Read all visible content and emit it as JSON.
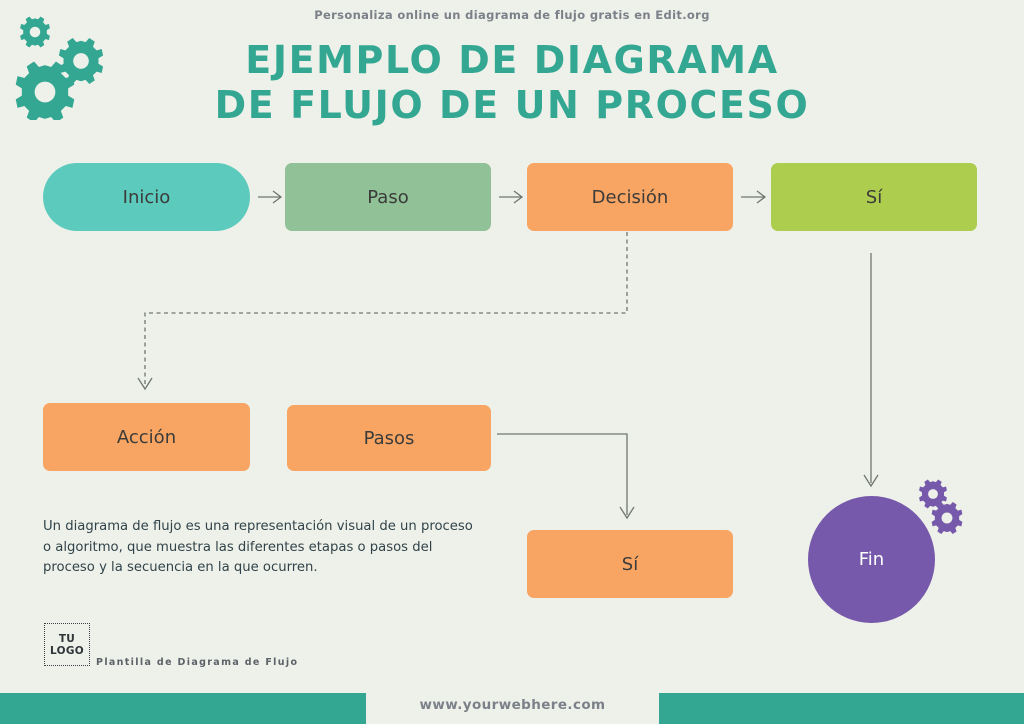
{
  "header": {
    "tagline": "Personaliza online un diagrama de flujo gratis en Edit.org",
    "title_line1": "EJEMPLO DE DIAGRAMA",
    "title_line2": "DE FLUJO DE UN PROCESO"
  },
  "colors": {
    "background": "#eef1e9",
    "teal": "#34a793",
    "start_node": "#5ccbbd",
    "step_node": "#90c197",
    "orange_node": "#f8a564",
    "lime_node": "#accd4d",
    "end_node": "#7759ab",
    "connector": "#6f7672",
    "text_dark": "#3b3b39",
    "text_muted": "#7c8189"
  },
  "nodes": [
    {
      "id": "inicio",
      "label": "Inicio"
    },
    {
      "id": "paso",
      "label": "Paso"
    },
    {
      "id": "decision",
      "label": "Decisión"
    },
    {
      "id": "si_top",
      "label": "Sí"
    },
    {
      "id": "accion",
      "label": "Acción"
    },
    {
      "id": "pasos",
      "label": "Pasos"
    },
    {
      "id": "si_bottom",
      "label": "Sí"
    },
    {
      "id": "fin",
      "label": "Fin"
    }
  ],
  "description": "Un diagrama de flujo es una representación visual de un proceso o algoritmo, que muestra las diferentes etapas o pasos del proceso y la secuencia en la que ocurren.",
  "logo": {
    "line1": "TU",
    "line2": "LOGO",
    "caption": "Plantilla de Diagrama de Flujo"
  },
  "footer": {
    "url": "www.yourwebhere.com"
  }
}
